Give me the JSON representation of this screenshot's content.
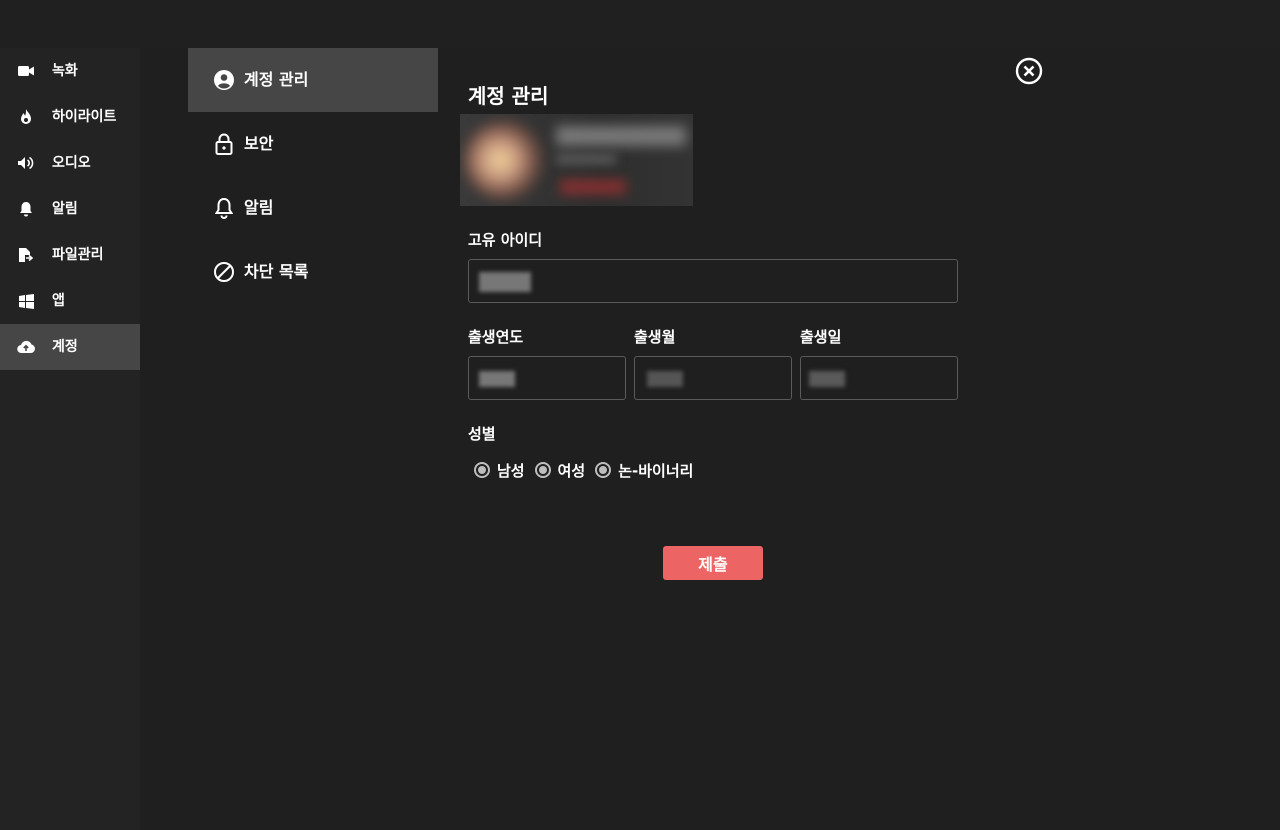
{
  "sidebar": {
    "items": [
      {
        "label": "녹화",
        "icon": "video-camera-icon"
      },
      {
        "label": "하이라이트",
        "icon": "flame-icon"
      },
      {
        "label": "오디오",
        "icon": "speaker-icon"
      },
      {
        "label": "알림",
        "icon": "bell-icon"
      },
      {
        "label": "파일관리",
        "icon": "file-export-icon"
      },
      {
        "label": "앱",
        "icon": "windows-icon"
      },
      {
        "label": "계정",
        "icon": "cloud-upload-icon",
        "active": true
      }
    ]
  },
  "submenu": {
    "items": [
      {
        "label": "계정 관리",
        "icon": "user-circle-icon",
        "active": true
      },
      {
        "label": "보안",
        "icon": "lock-icon"
      },
      {
        "label": "알림",
        "icon": "bell-outline-icon"
      },
      {
        "label": "차단 목록",
        "icon": "block-icon"
      }
    ]
  },
  "main": {
    "title": "계정 관리",
    "unique_id_label": "고유 아이디",
    "birth_year_label": "출생연도",
    "birth_month_label": "출생월",
    "birth_day_label": "출생일",
    "gender_label": "성별",
    "gender_options": [
      "남성",
      "여성",
      "논-바이너리"
    ],
    "submit_label": "제출"
  },
  "colors": {
    "background": "#1f1f1f",
    "sidebar": "#232323",
    "active": "#464646",
    "accent": "#ec6464"
  }
}
